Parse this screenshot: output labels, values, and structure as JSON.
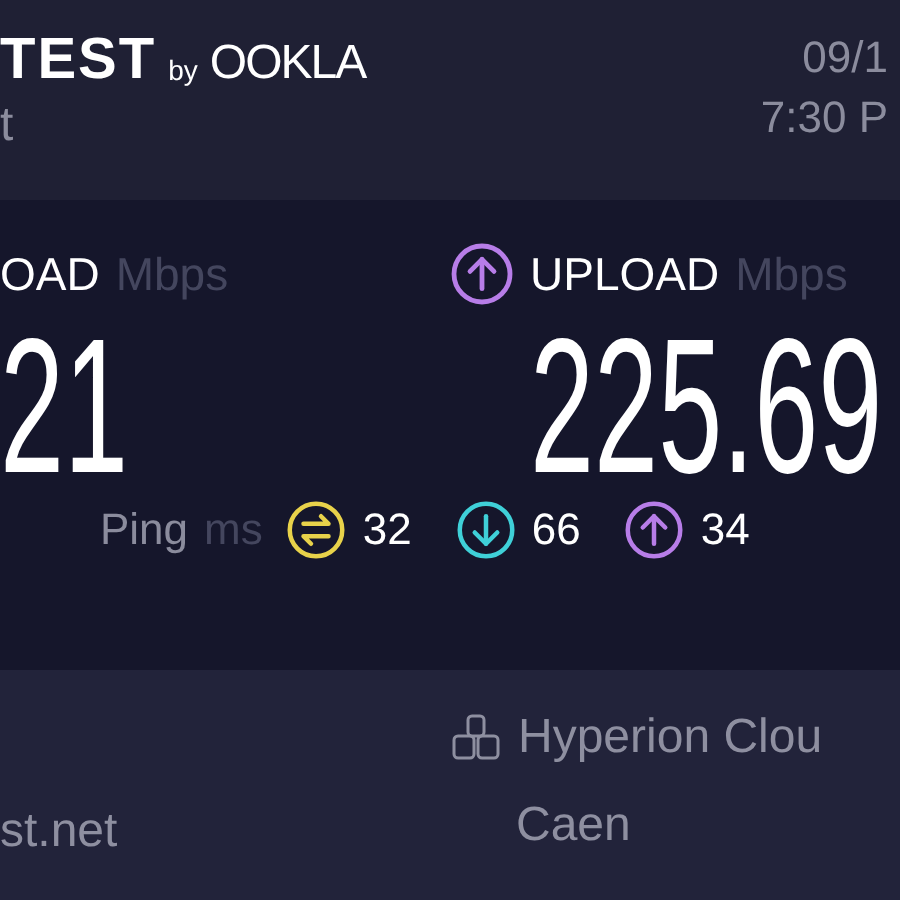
{
  "header": {
    "brand": "TEST",
    "brand_by": "by",
    "brand_company": "OOKLA",
    "subtitle": "t",
    "date": "09/1",
    "time": "7:30 P"
  },
  "results": [
    {
      "label": "OAD",
      "unit": "Mbps",
      "value": "21"
    },
    {
      "label": "UPLOAD",
      "unit": "Mbps",
      "value": "225.69",
      "kind": "upload"
    }
  ],
  "ping": {
    "label": "Ping",
    "unit": "ms",
    "items": [
      {
        "kind": "idle",
        "value": "32"
      },
      {
        "kind": "download",
        "value": "66"
      },
      {
        "kind": "upload",
        "value": "34"
      }
    ]
  },
  "footer": {
    "provider": "st.net",
    "server": "Hyperion Clou",
    "location": "Caen"
  }
}
